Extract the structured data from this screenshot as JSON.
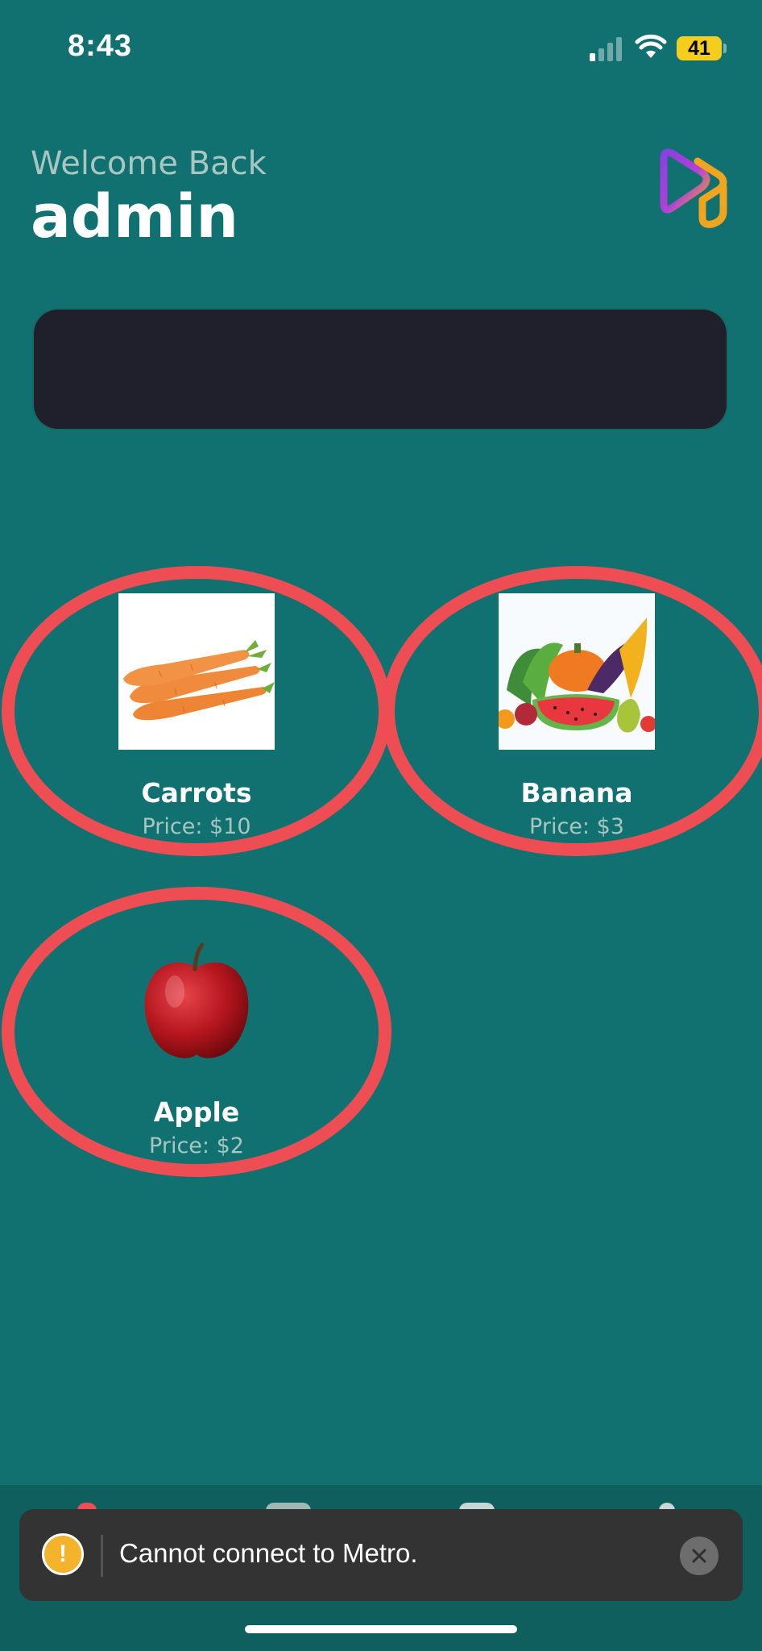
{
  "status_bar": {
    "time": "8:43",
    "battery": "41",
    "icons": [
      "signal-icon",
      "wifi-icon",
      "battery-icon"
    ]
  },
  "header": {
    "welcome": "Welcome Back",
    "username": "admin",
    "logo_icon": "app-logo-icon"
  },
  "products": [
    {
      "name": "Carrots",
      "price": "Price: $10",
      "image": "carrots-image"
    },
    {
      "name": "Banana",
      "price": "Price: $3",
      "image": "vegetables-image"
    },
    {
      "name": "Apple",
      "price": "Price: $2",
      "image": "apple-image"
    }
  ],
  "toast": {
    "message": "Cannot connect to Metro.",
    "icon": "warning-icon",
    "close_icon": "close-icon"
  },
  "colors": {
    "background": "#117171",
    "card_outline": "#ee4e53",
    "banner": "#20202c",
    "toast": "#333333"
  }
}
